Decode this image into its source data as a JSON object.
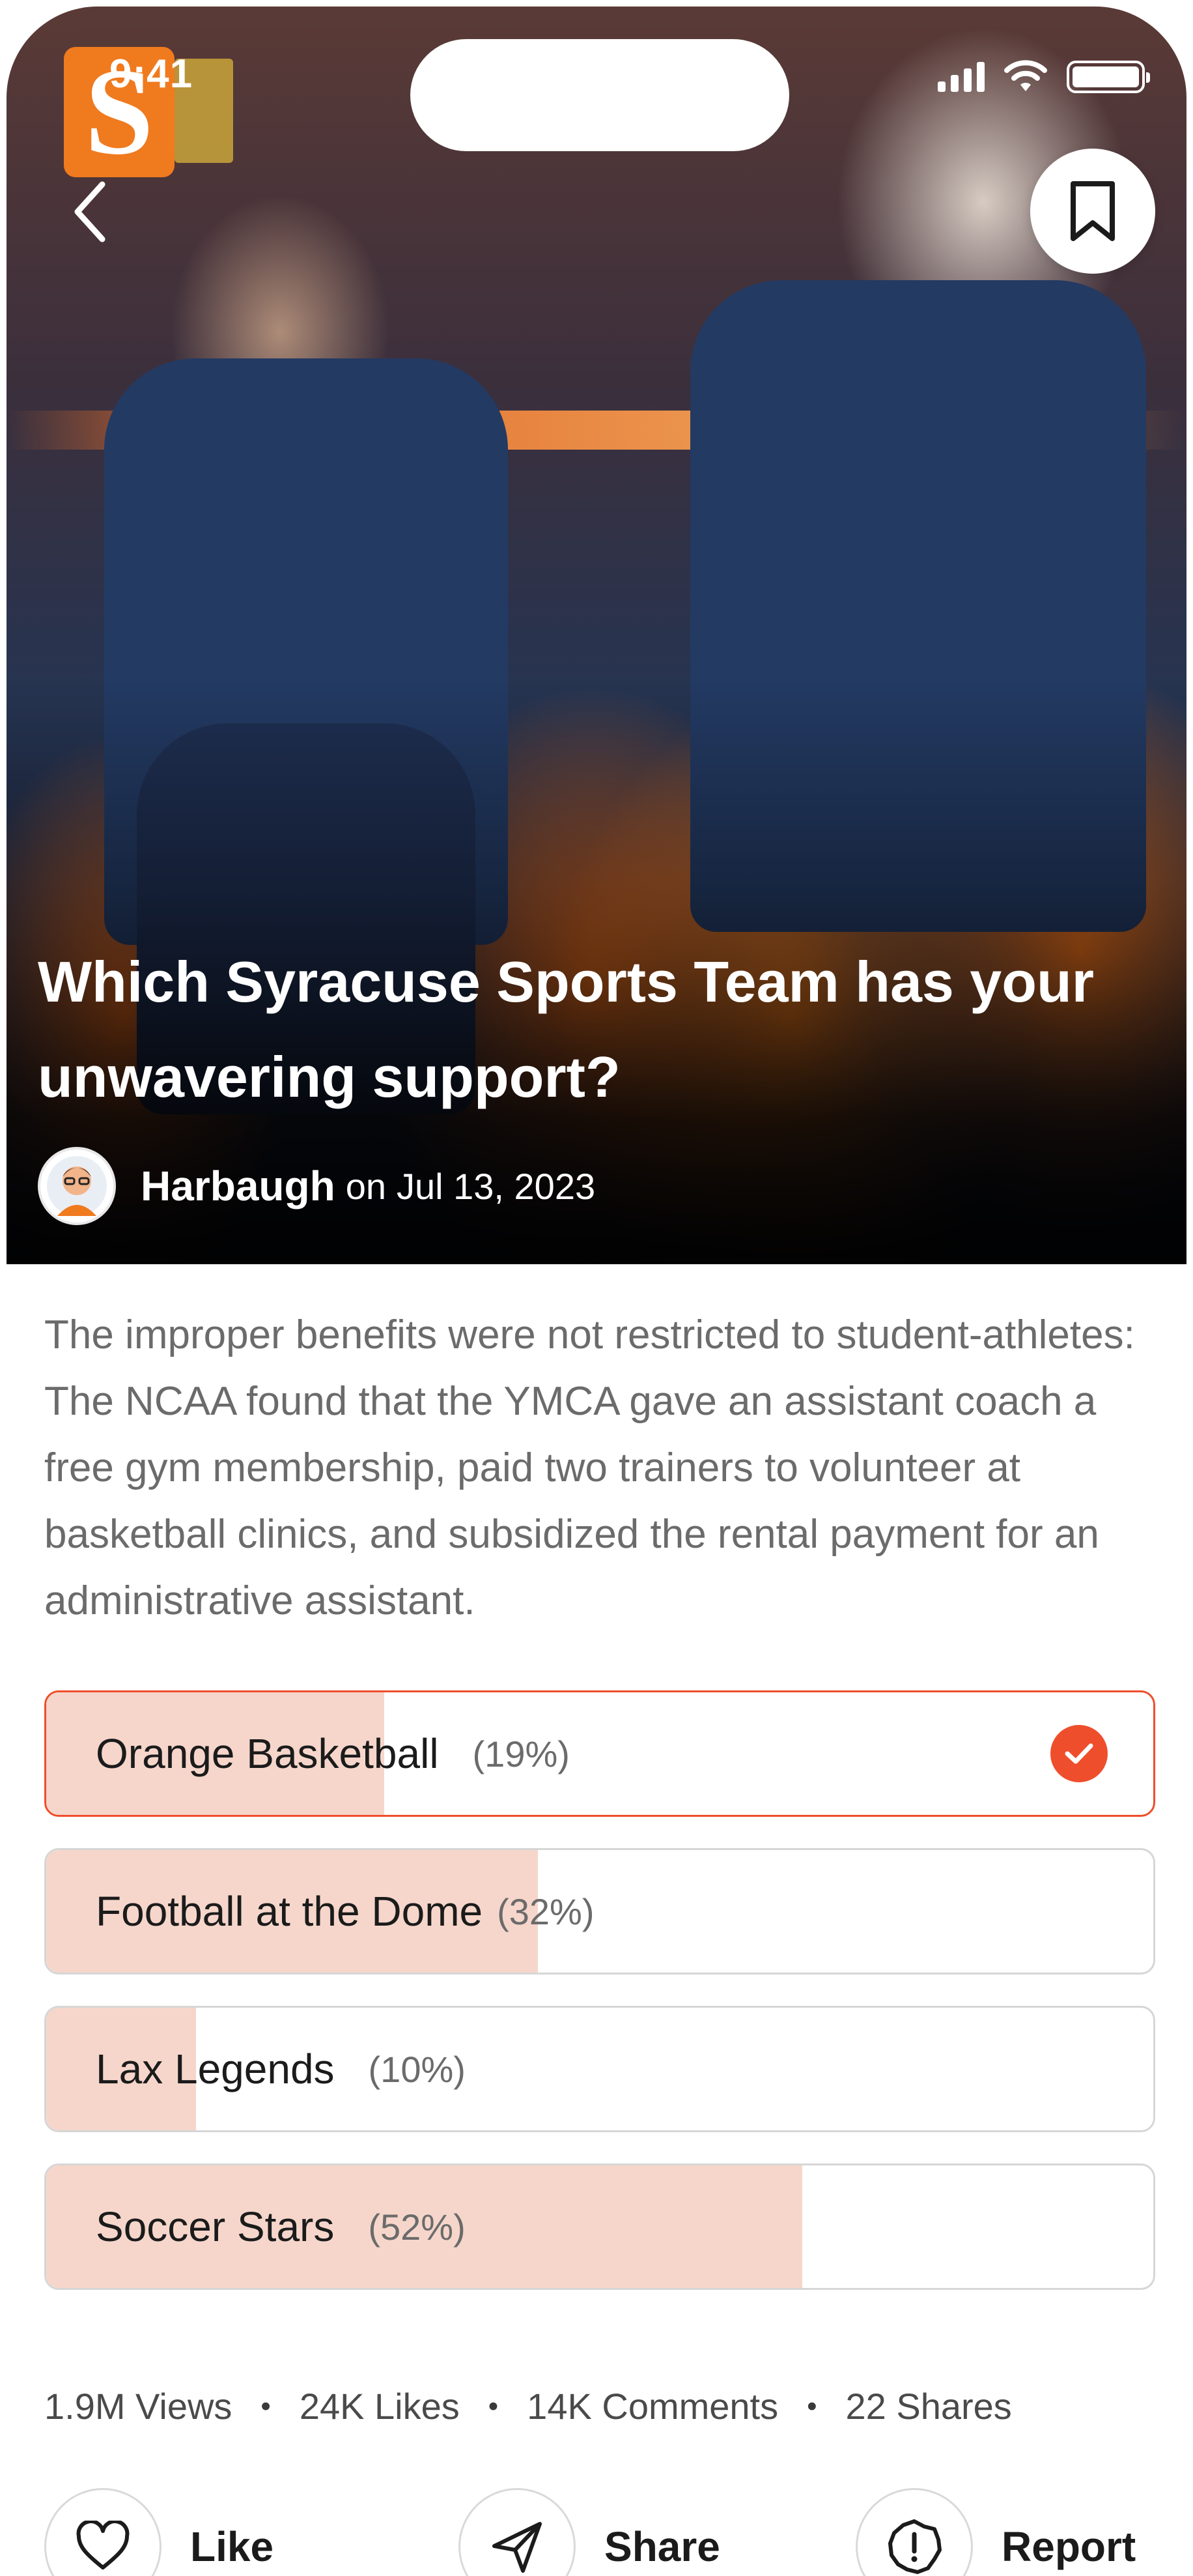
{
  "status_bar": {
    "time": "9:41"
  },
  "hero": {
    "logo_letter": "S",
    "title": "Which Syracuse Sports Team has your unwavering support?",
    "author": {
      "name": "Harbaugh",
      "on": "on",
      "date": "Jul 13, 2023"
    }
  },
  "description": "The improper benefits were not restricted to student-athletes: The NCAA found that the YMCA gave an assistant coach a free gym membership, paid two trainers to volunteer at basketball clinics, and subsidized the rental payment for an administrative assistant.",
  "poll": {
    "accent_color": "#ef4e2c",
    "fill_color": "#f6d6cb",
    "options": [
      {
        "label": "Orange Basketball",
        "percent_text": "(19%)",
        "percent": 19,
        "selected": true
      },
      {
        "label": "Football at the Dome",
        "percent_text": "(32%)",
        "percent": 32,
        "selected": false
      },
      {
        "label": "Lax Legends",
        "percent_text": "(10%)",
        "percent": 10,
        "selected": false
      },
      {
        "label": "Soccer Stars",
        "percent_text": "(52%)",
        "percent": 52,
        "selected": false
      }
    ]
  },
  "stats": {
    "views": "1.9M Views",
    "likes": "24K Likes",
    "comments": "14K Comments",
    "shares": "22 Shares",
    "separator": "•"
  },
  "actions": {
    "like": "Like",
    "share": "Share",
    "report": "Report"
  },
  "icons": [
    "back-icon",
    "bookmark-icon",
    "signal-icon",
    "wifi-icon",
    "battery-icon",
    "check-icon",
    "heart-icon",
    "send-icon",
    "report-icon",
    "avatar-icon"
  ]
}
